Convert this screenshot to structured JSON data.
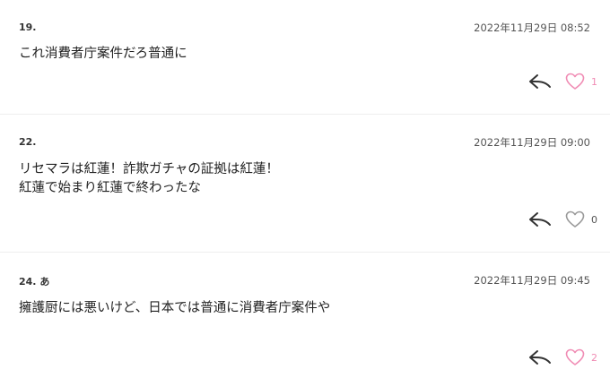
{
  "comments": [
    {
      "number": "19.",
      "date": "2022年11月29日 08:52",
      "text": "これ消費者庁案件だろ普通に",
      "likes": "1",
      "liked_color": "#f08cb4"
    },
    {
      "number": "22.",
      "date": "2022年11月29日 09:00",
      "text": "リセマラは紅蓮！詐欺ガチャの証拠は紅蓮！\n紅蓮で始まり紅蓮で終わったな",
      "likes": "0",
      "liked_color": "#999999"
    },
    {
      "number": "24. あ",
      "date": "2022年11月29日 09:45",
      "text": "擁護厨には悪いけど、日本では普通に消費者庁案件や",
      "likes": "2",
      "liked_color": "#f08cb4"
    }
  ],
  "icons": {
    "reply": "reply-arrow-icon",
    "like": "heart-outline-icon"
  }
}
